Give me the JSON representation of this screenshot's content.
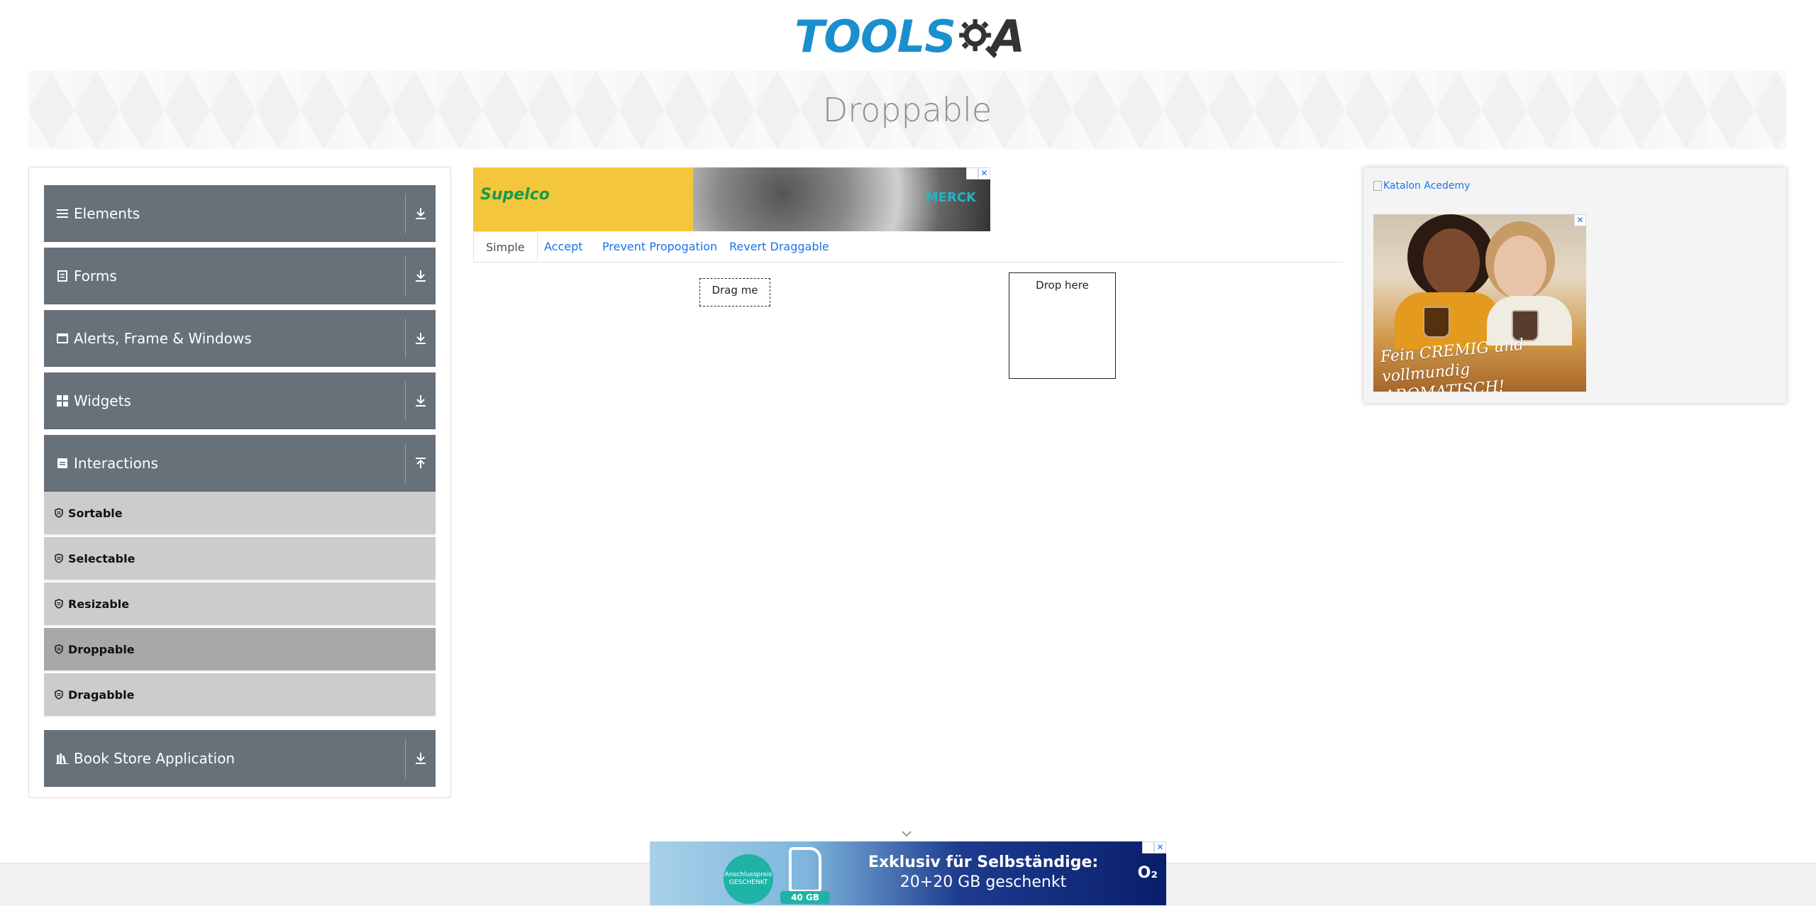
{
  "header": {
    "logo_part1": "TOOLS",
    "logo_part2": "A",
    "page_title": "Droppable"
  },
  "sidebar": {
    "groups": [
      {
        "label": "Elements",
        "icon": "list-icon",
        "arrow": "download-icon"
      },
      {
        "label": "Forms",
        "icon": "form-icon",
        "arrow": "download-icon"
      },
      {
        "label": "Alerts, Frame & Windows",
        "icon": "window-icon",
        "arrow": "download-icon"
      },
      {
        "label": "Widgets",
        "icon": "grid-icon",
        "arrow": "download-icon"
      },
      {
        "label": "Interactions",
        "icon": "interactions-icon",
        "arrow": "upload-icon"
      },
      {
        "label": "Book Store Application",
        "icon": "books-icon",
        "arrow": "download-icon"
      }
    ],
    "interaction_items": [
      {
        "label": "Sortable",
        "active": false
      },
      {
        "label": "Selectable",
        "active": false
      },
      {
        "label": "Resizable",
        "active": false
      },
      {
        "label": "Droppable",
        "active": true
      },
      {
        "label": "Dragabble",
        "active": false
      }
    ]
  },
  "ads": {
    "top_brand": "Supelco",
    "top_partner": "MERCK",
    "right_link": "Katalon Acedemy",
    "right_slogan": "Fein CREMIG und vollmundig AROMATISCH!",
    "bottom_badge": "Anschlusspreis GESCHENKT",
    "bottom_gb": "40 GB",
    "bottom_headline": "Exklusiv für Selbständige:",
    "bottom_subline": "20+20 GB geschenkt",
    "bottom_logo": "O₂",
    "close_glyph": "✕"
  },
  "tabs": [
    {
      "label": "Simple",
      "active": true
    },
    {
      "label": "Accept",
      "active": false
    },
    {
      "label": "Prevent Propogation",
      "active": false
    },
    {
      "label": "Revert Draggable",
      "active": false
    }
  ],
  "droppable": {
    "drag_label": "Drag me",
    "drop_label": "Drop here"
  },
  "colors": {
    "brand_blue": "#1a8fcd",
    "sidebar_group": "#687079",
    "sidebar_item": "#cccccc",
    "sidebar_item_active": "#a8a8a8",
    "link_blue": "#1a73e8"
  }
}
